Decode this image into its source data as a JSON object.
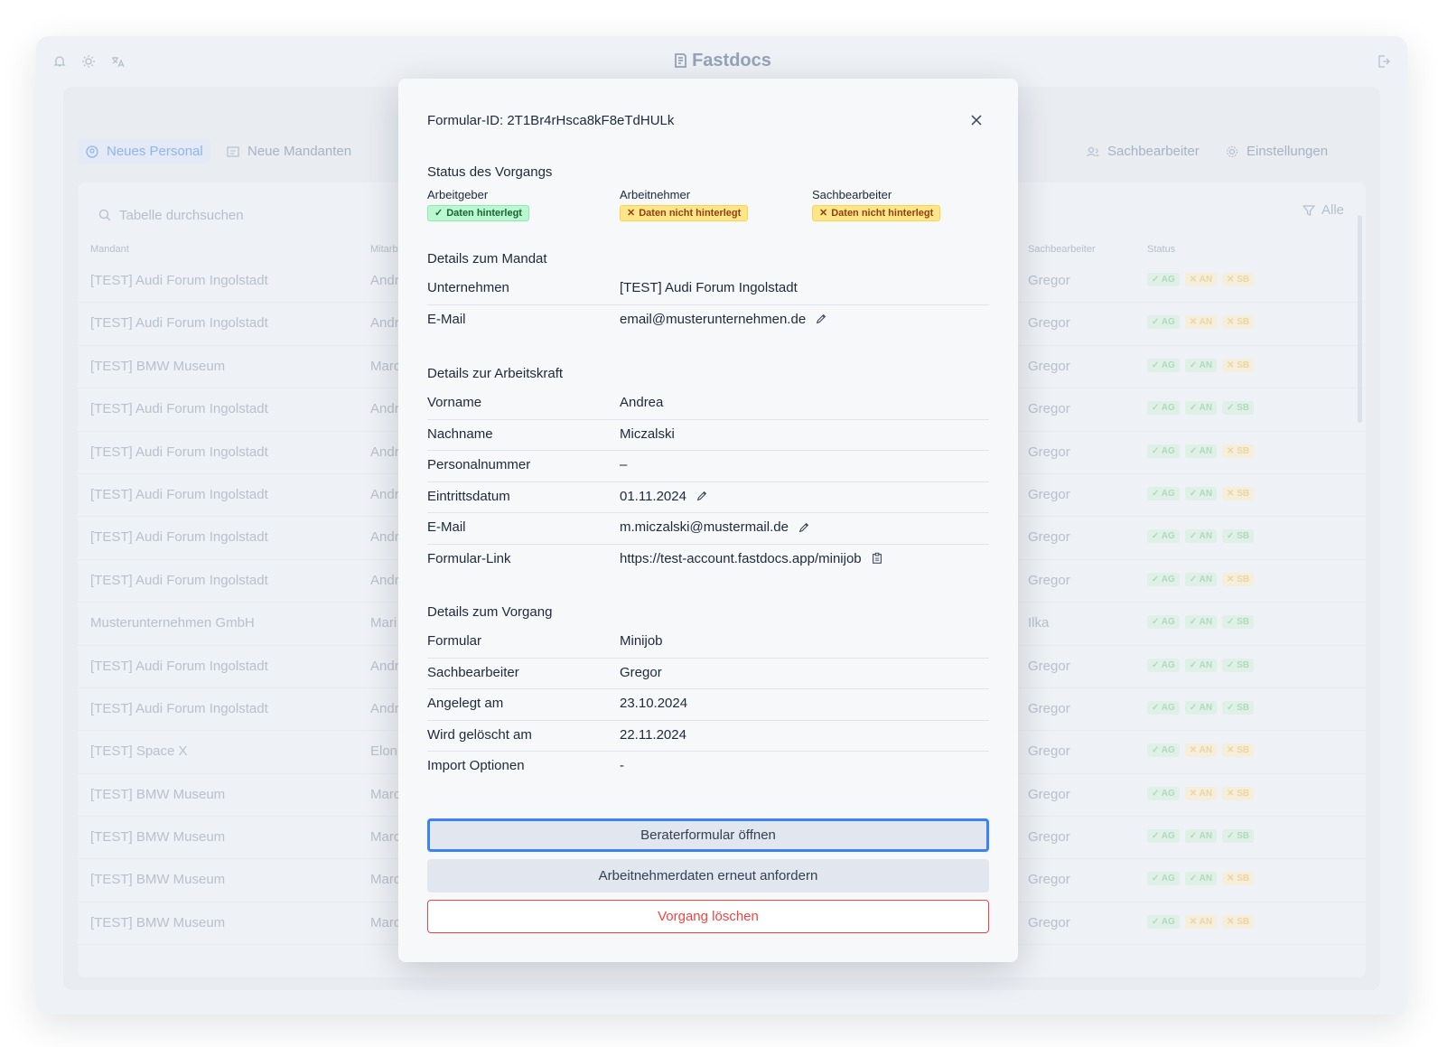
{
  "app": {
    "brand": "Fastdocs"
  },
  "tabs": [
    {
      "label": "Neues Personal",
      "icon": "users-icon"
    },
    {
      "label": "Neue Mandanten",
      "icon": "building-icon"
    },
    {
      "label": "Sachbearbeiter",
      "icon": "user-group-icon"
    },
    {
      "label": "Einstellungen",
      "icon": "gear-icon"
    }
  ],
  "search": {
    "placeholder": "Tabelle durchsuchen"
  },
  "filter": {
    "label": "Alle"
  },
  "table": {
    "headers": {
      "mandant": "Mandant",
      "mitarbeiter": "Mitarb",
      "sachbearbeiter": "Sachbearbeiter",
      "status": "Status"
    },
    "rows": [
      {
        "mandant": "[TEST] Audi Forum Ingolstadt",
        "mitarbeiter": "Andr",
        "sb": "Gregor",
        "st": [
          "ok",
          "no",
          "no"
        ]
      },
      {
        "mandant": "[TEST] Audi Forum Ingolstadt",
        "mitarbeiter": "Andr",
        "sb": "Gregor",
        "st": [
          "ok",
          "no",
          "no"
        ]
      },
      {
        "mandant": "[TEST] BMW Museum",
        "mitarbeiter": "Marc",
        "sb": "Gregor",
        "st": [
          "ok",
          "ok",
          "no"
        ]
      },
      {
        "mandant": "[TEST] Audi Forum Ingolstadt",
        "mitarbeiter": "Andr",
        "sb": "Gregor",
        "st": [
          "ok",
          "ok",
          "ok"
        ]
      },
      {
        "mandant": "[TEST] Audi Forum Ingolstadt",
        "mitarbeiter": "Andr",
        "sb": "Gregor",
        "st": [
          "ok",
          "ok",
          "no"
        ]
      },
      {
        "mandant": "[TEST] Audi Forum Ingolstadt",
        "mitarbeiter": "Andr",
        "sb": "Gregor",
        "st": [
          "ok",
          "ok",
          "no"
        ]
      },
      {
        "mandant": "[TEST] Audi Forum Ingolstadt",
        "mitarbeiter": "Andr",
        "sb": "Gregor",
        "st": [
          "ok",
          "ok",
          "ok"
        ]
      },
      {
        "mandant": "[TEST] Audi Forum Ingolstadt",
        "mitarbeiter": "Andr",
        "sb": "Gregor",
        "st": [
          "ok",
          "ok",
          "no"
        ]
      },
      {
        "mandant": "Musterunternehmen GmbH",
        "mitarbeiter": "Mari",
        "sb": "Ilka",
        "st": [
          "ok",
          "ok",
          "ok"
        ]
      },
      {
        "mandant": "[TEST] Audi Forum Ingolstadt",
        "mitarbeiter": "Andr",
        "sb": "Gregor",
        "st": [
          "ok",
          "ok",
          "ok"
        ]
      },
      {
        "mandant": "[TEST] Audi Forum Ingolstadt",
        "mitarbeiter": "Andr",
        "sb": "Gregor",
        "st": [
          "ok",
          "ok",
          "ok"
        ]
      },
      {
        "mandant": "[TEST] Space X",
        "mitarbeiter": "Elon",
        "sb": "Gregor",
        "st": [
          "ok",
          "no",
          "no"
        ]
      },
      {
        "mandant": "[TEST] BMW Museum",
        "mitarbeiter": "Marc",
        "sb": "Gregor",
        "st": [
          "ok",
          "no",
          "no"
        ]
      },
      {
        "mandant": "[TEST] BMW Museum",
        "mitarbeiter": "Marc",
        "sb": "Gregor",
        "st": [
          "ok",
          "ok",
          "ok"
        ]
      },
      {
        "mandant": "[TEST] BMW Museum",
        "mitarbeiter": "Marc",
        "sb": "Gregor",
        "st": [
          "ok",
          "ok",
          "no"
        ]
      },
      {
        "mandant": "[TEST] BMW Museum",
        "mitarbeiter": "Marc",
        "sb": "Gregor",
        "st": [
          "ok",
          "no",
          "no"
        ]
      }
    ],
    "status_codes": [
      "AG",
      "AN",
      "SB"
    ]
  },
  "modal": {
    "title": "Formular-ID: 2T1Br4rHsca8kF8eTdHULk",
    "status_section": "Status des Vorgangs",
    "status": [
      {
        "label": "Arbeitgeber",
        "badge": "Daten hinterlegt",
        "state": "ok"
      },
      {
        "label": "Arbeitnehmer",
        "badge": "Daten nicht hinterlegt",
        "state": "no"
      },
      {
        "label": "Sachbearbeiter",
        "badge": "Daten nicht hinterlegt",
        "state": "no"
      }
    ],
    "mandat_section": "Details zum Mandat",
    "mandat": [
      {
        "key": "Unternehmen",
        "value": "[TEST] Audi Forum Ingolstadt",
        "action": ""
      },
      {
        "key": "E-Mail",
        "value": "email@musterunternehmen.de",
        "action": "edit"
      }
    ],
    "arbeitskraft_section": "Details zur Arbeitskraft",
    "arbeitskraft": [
      {
        "key": "Vorname",
        "value": "Andrea",
        "action": ""
      },
      {
        "key": "Nachname",
        "value": "Miczalski",
        "action": ""
      },
      {
        "key": "Personalnummer",
        "value": "–",
        "action": ""
      },
      {
        "key": "Eintrittsdatum",
        "value": "01.11.2024",
        "action": "edit"
      },
      {
        "key": "E-Mail",
        "value": "m.miczalski@mustermail.de",
        "action": "edit"
      },
      {
        "key": "Formular-Link",
        "value": "https://test-account.fastdocs.app/minijob",
        "action": "copy"
      }
    ],
    "vorgang_section": "Details zum Vorgang",
    "vorgang": [
      {
        "key": "Formular",
        "value": "Minijob"
      },
      {
        "key": "Sachbearbeiter",
        "value": "Gregor"
      },
      {
        "key": "Angelegt am",
        "value": "23.10.2024"
      },
      {
        "key": "Wird gelöscht am",
        "value": "22.11.2024"
      },
      {
        "key": "Import Optionen",
        "value": "-"
      }
    ],
    "buttons": {
      "primary": "Beraterformular öffnen",
      "secondary": "Arbeitnehmerdaten erneut anfordern",
      "danger": "Vorgang löschen"
    }
  },
  "colors": {
    "accent": "#3b82f6",
    "danger": "#ef4444",
    "ok_badge": "#bbf7d0",
    "warn_badge": "#fde68a"
  }
}
